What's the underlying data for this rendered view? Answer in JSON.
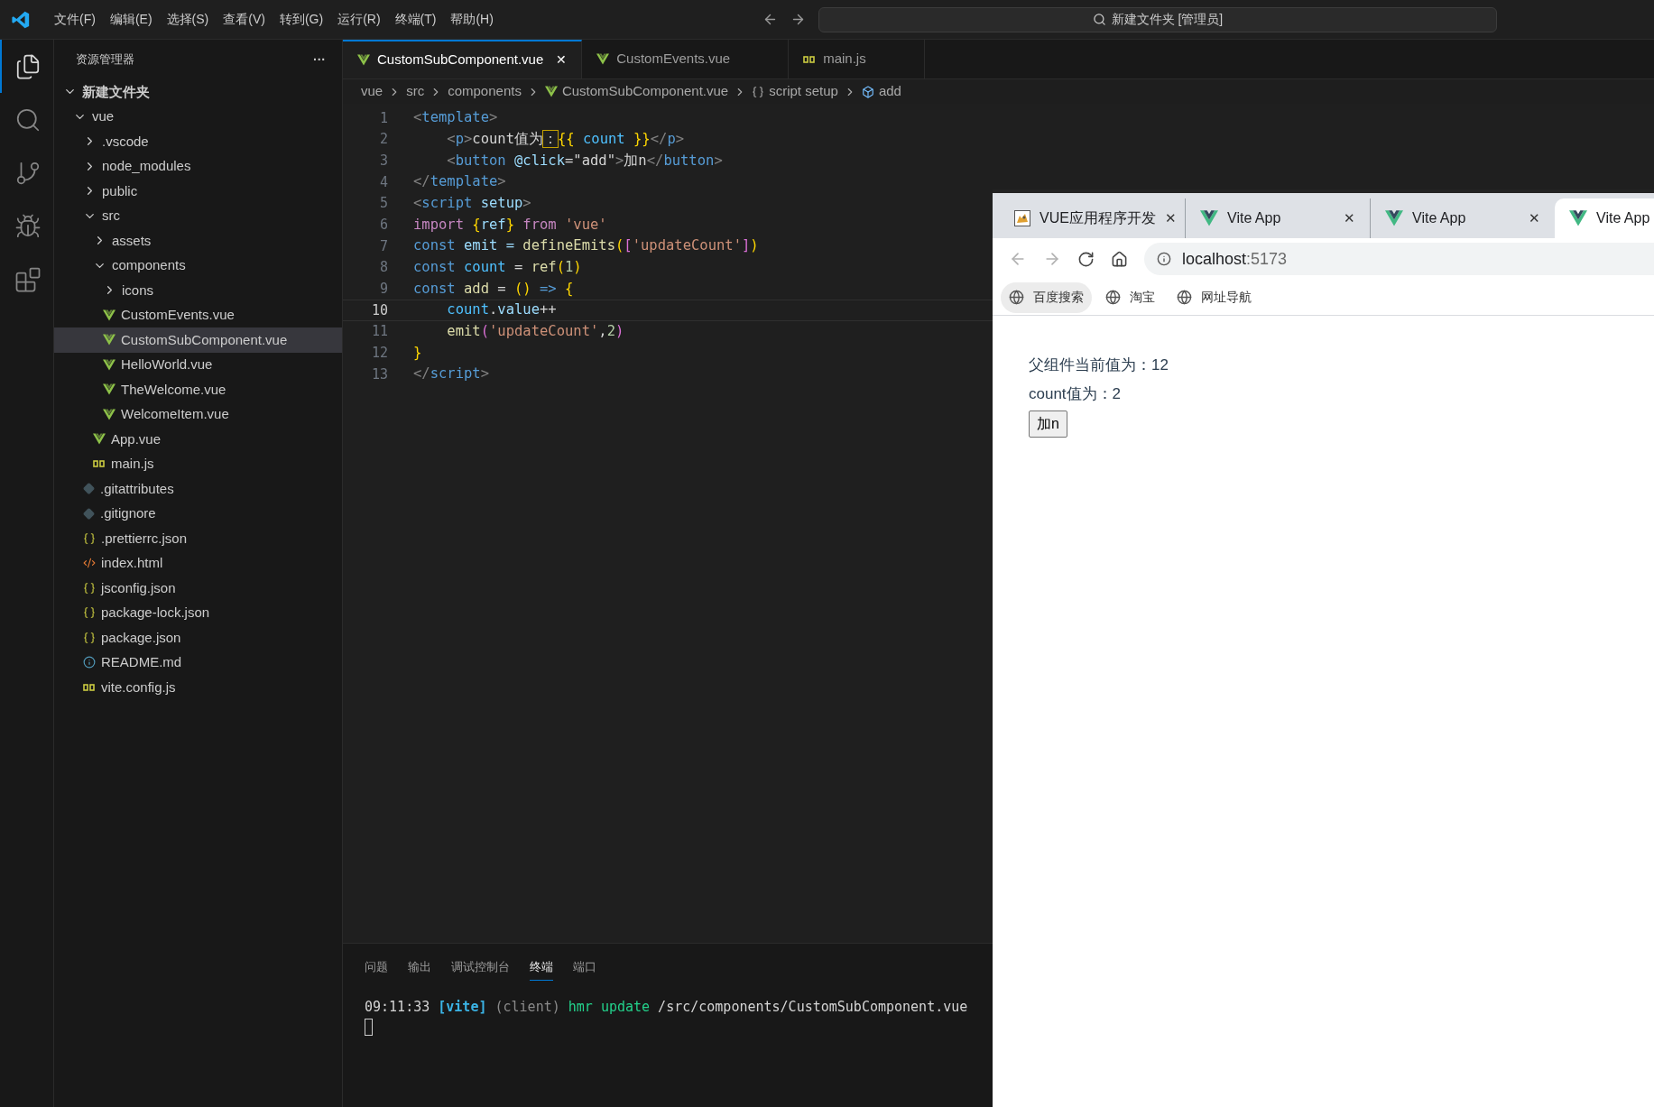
{
  "menu": [
    "文件(F)",
    "编辑(E)",
    "选择(S)",
    "查看(V)",
    "转到(G)",
    "运行(R)",
    "终端(T)",
    "帮助(H)"
  ],
  "command_center": {
    "text": "新建文件夹 [管理员]"
  },
  "activity_bar": [
    {
      "kind": "explorer",
      "selected": true
    },
    {
      "kind": "search",
      "selected": false
    },
    {
      "kind": "source-control",
      "selected": false
    },
    {
      "kind": "run-debug",
      "selected": false
    },
    {
      "kind": "extensions",
      "selected": false
    }
  ],
  "sidebar": {
    "title": "资源管理器",
    "more": "···",
    "tree": [
      {
        "label": "新建文件夹",
        "kind": "root",
        "expanded": true,
        "selected": false,
        "children": [
          {
            "label": "vue",
            "kind": "folder",
            "expanded": true,
            "selected": false,
            "children": [
              {
                "label": ".vscode",
                "kind": "folder",
                "expanded": false,
                "selected": false
              },
              {
                "label": "node_modules",
                "kind": "folder",
                "expanded": false,
                "selected": false
              },
              {
                "label": "public",
                "kind": "folder",
                "expanded": false,
                "selected": false
              },
              {
                "label": "src",
                "kind": "folder",
                "expanded": true,
                "selected": false,
                "children": [
                  {
                    "label": "assets",
                    "kind": "folder",
                    "expanded": false,
                    "selected": false
                  },
                  {
                    "label": "components",
                    "kind": "folder",
                    "expanded": true,
                    "selected": false,
                    "children": [
                      {
                        "label": "icons",
                        "kind": "folder",
                        "expanded": false,
                        "selected": false
                      },
                      {
                        "label": "CustomEvents.vue",
                        "kind": "vue",
                        "selected": false
                      },
                      {
                        "label": "CustomSubComponent.vue",
                        "kind": "vue",
                        "selected": true
                      },
                      {
                        "label": "HelloWorld.vue",
                        "kind": "vue",
                        "selected": false
                      },
                      {
                        "label": "TheWelcome.vue",
                        "kind": "vue",
                        "selected": false
                      },
                      {
                        "label": "WelcomeItem.vue",
                        "kind": "vue",
                        "selected": false
                      }
                    ]
                  },
                  {
                    "label": "App.vue",
                    "kind": "vue",
                    "selected": false
                  },
                  {
                    "label": "main.js",
                    "kind": "js",
                    "selected": false
                  }
                ]
              },
              {
                "label": ".gitattributes",
                "kind": "git",
                "selected": false
              },
              {
                "label": ".gitignore",
                "kind": "git",
                "selected": false
              },
              {
                "label": ".prettierrc.json",
                "kind": "json",
                "selected": false
              },
              {
                "label": "index.html",
                "kind": "html",
                "selected": false
              },
              {
                "label": "jsconfig.json",
                "kind": "json",
                "selected": false
              },
              {
                "label": "package-lock.json",
                "kind": "json",
                "selected": false
              },
              {
                "label": "package.json",
                "kind": "json",
                "selected": false
              },
              {
                "label": "README.md",
                "kind": "info",
                "selected": false
              },
              {
                "label": "vite.config.js",
                "kind": "js",
                "selected": false
              }
            ]
          }
        ]
      }
    ]
  },
  "editor_tabs": [
    {
      "label": "CustomSubComponent.vue",
      "kind": "vue",
      "selected": true,
      "close": "✕"
    },
    {
      "label": "CustomEvents.vue",
      "kind": "vue",
      "selected": false
    },
    {
      "label": "main.js",
      "kind": "js",
      "selected": false
    }
  ],
  "breadcrumb": [
    {
      "label": "vue",
      "kind": "folder"
    },
    {
      "label": "src",
      "kind": "folder"
    },
    {
      "label": "components",
      "kind": "folder"
    },
    {
      "label": "CustomSubComponent.vue",
      "kind": "vue"
    },
    {
      "label": "script setup",
      "kind": "braces"
    },
    {
      "label": "add",
      "kind": "symbol"
    }
  ],
  "code_lines": [
    {
      "number": "1",
      "active": false,
      "tokens": [
        {
          "text": "<",
          "kind": "punct"
        },
        {
          "text": "template",
          "kind": "tag"
        },
        {
          "text": ">",
          "kind": "punct"
        }
      ]
    },
    {
      "number": "2",
      "active": false,
      "tokens": [
        {
          "text": "    <",
          "kind": "punct"
        },
        {
          "text": "p",
          "kind": "tag"
        },
        {
          "text": ">",
          "kind": "punct"
        },
        {
          "text": "count值为",
          "kind": "plain"
        },
        {
          "text": "：",
          "kind": "warn"
        },
        {
          "text": "{{",
          "kind": "brace"
        },
        {
          "text": " count ",
          "kind": "var"
        },
        {
          "text": "}}",
          "kind": "brace"
        },
        {
          "text": "</",
          "kind": "punct"
        },
        {
          "text": "p",
          "kind": "tag"
        },
        {
          "text": ">",
          "kind": "punct"
        }
      ]
    },
    {
      "number": "3",
      "active": false,
      "tokens": [
        {
          "text": "    <",
          "kind": "punct"
        },
        {
          "text": "button",
          "kind": "tag"
        },
        {
          "text": " @click",
          "kind": "attr"
        },
        {
          "text": "=",
          "kind": "plain"
        },
        {
          "text": "\"add\"",
          "kind": "plain"
        },
        {
          "text": ">",
          "kind": "punct"
        },
        {
          "text": "加n",
          "kind": "plain"
        },
        {
          "text": "</",
          "kind": "punct"
        },
        {
          "text": "button",
          "kind": "tag"
        },
        {
          "text": ">",
          "kind": "punct"
        }
      ]
    },
    {
      "number": "4",
      "active": false,
      "tokens": [
        {
          "text": "</",
          "kind": "punct"
        },
        {
          "text": "template",
          "kind": "tag"
        },
        {
          "text": ">",
          "kind": "punct"
        }
      ]
    },
    {
      "number": "5",
      "active": false,
      "tokens": [
        {
          "text": "<",
          "kind": "punct"
        },
        {
          "text": "script",
          "kind": "tag"
        },
        {
          "text": " setup",
          "kind": "attr"
        },
        {
          "text": ">",
          "kind": "punct"
        }
      ]
    },
    {
      "number": "6",
      "active": false,
      "tokens": [
        {
          "text": "import",
          "kind": "control"
        },
        {
          "text": " {",
          "kind": "brace"
        },
        {
          "text": "ref",
          "kind": "attr"
        },
        {
          "text": "}",
          "kind": "brace"
        },
        {
          "text": " from",
          "kind": "control"
        },
        {
          "text": " 'vue'",
          "kind": "string"
        }
      ]
    },
    {
      "number": "7",
      "active": false,
      "tokens": [
        {
          "text": "const",
          "kind": "keyword"
        },
        {
          "text": " emit = ",
          "kind": "attr"
        },
        {
          "text": "defineEmits",
          "kind": "func"
        },
        {
          "text": "(",
          "kind": "brace"
        },
        {
          "text": "[",
          "kind": "paren"
        },
        {
          "text": "'updateCount'",
          "kind": "string"
        },
        {
          "text": "]",
          "kind": "paren"
        },
        {
          "text": ")",
          "kind": "brace"
        }
      ]
    },
    {
      "number": "8",
      "active": false,
      "tokens": [
        {
          "text": "const",
          "kind": "keyword"
        },
        {
          "text": " count",
          "kind": "var"
        },
        {
          "text": " = ",
          "kind": "plain"
        },
        {
          "text": "ref",
          "kind": "func"
        },
        {
          "text": "(",
          "kind": "brace"
        },
        {
          "text": "1",
          "kind": "number"
        },
        {
          "text": ")",
          "kind": "brace"
        }
      ]
    },
    {
      "number": "9",
      "active": false,
      "tokens": [
        {
          "text": "const",
          "kind": "keyword"
        },
        {
          "text": " add",
          "kind": "func"
        },
        {
          "text": " = ",
          "kind": "plain"
        },
        {
          "text": "()",
          "kind": "brace"
        },
        {
          "text": " =>",
          "kind": "keyword"
        },
        {
          "text": " {",
          "kind": "brace"
        }
      ]
    },
    {
      "number": "10",
      "active": true,
      "tokens": [
        {
          "text": "    count",
          "kind": "var"
        },
        {
          "text": ".",
          "kind": "plain"
        },
        {
          "text": "value",
          "kind": "attr"
        },
        {
          "text": "++",
          "kind": "plain"
        }
      ]
    },
    {
      "number": "11",
      "active": false,
      "tokens": [
        {
          "text": "    emit",
          "kind": "func"
        },
        {
          "text": "(",
          "kind": "paren"
        },
        {
          "text": "'updateCount'",
          "kind": "string"
        },
        {
          "text": ",",
          "kind": "plain"
        },
        {
          "text": "2",
          "kind": "number"
        },
        {
          "text": ")",
          "kind": "paren"
        }
      ]
    },
    {
      "number": "12",
      "active": false,
      "tokens": [
        {
          "text": "}",
          "kind": "brace"
        }
      ]
    },
    {
      "number": "13",
      "active": false,
      "tokens": [
        {
          "text": "</",
          "kind": "punct"
        },
        {
          "text": "script",
          "kind": "tag"
        },
        {
          "text": ">",
          "kind": "punct"
        }
      ]
    }
  ],
  "panel": {
    "tabs": [
      {
        "label": "问题",
        "selected": false
      },
      {
        "label": "输出",
        "selected": false
      },
      {
        "label": "调试控制台",
        "selected": false
      },
      {
        "label": "终端",
        "selected": true
      },
      {
        "label": "端口",
        "selected": false
      }
    ],
    "terminal_line": [
      {
        "text": "09:11:33 ",
        "kind": "plain"
      },
      {
        "text": "[vite]",
        "kind": "vite"
      },
      {
        "text": " (client)",
        "kind": "dim"
      },
      {
        "text": " hmr update",
        "kind": "green"
      },
      {
        "text": " /src/components/CustomSubComponent.vue",
        "kind": "plain"
      }
    ]
  },
  "browser": {
    "tabs": [
      {
        "label": "VUE应用程序开发",
        "kind": "cat",
        "selected": false,
        "close": "✕"
      },
      {
        "label": "Vite App",
        "kind": "vue",
        "selected": false,
        "close": "✕"
      },
      {
        "label": "Vite App",
        "kind": "vue",
        "selected": false,
        "close": "✕"
      },
      {
        "label": "Vite App",
        "kind": "vue",
        "selected": true
      }
    ],
    "address": {
      "host": "localhost",
      "port": ":5173"
    },
    "bookmarks": [
      {
        "label": "百度搜索",
        "selected": true
      },
      {
        "label": "淘宝",
        "selected": false
      },
      {
        "label": "网址导航",
        "selected": false
      }
    ],
    "page": {
      "lines": [
        "父组件当前值为：12",
        "count值为：2"
      ],
      "button": "加n"
    }
  }
}
